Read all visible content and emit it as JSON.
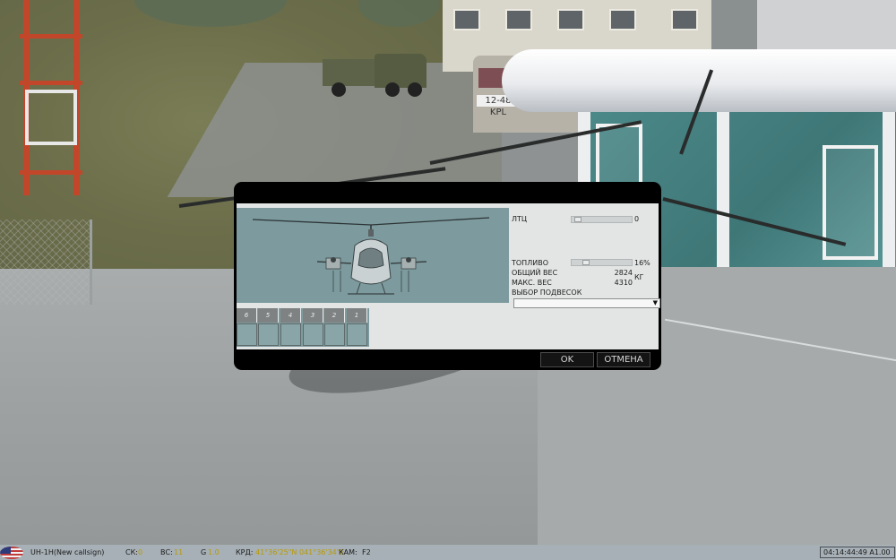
{
  "scene": {
    "bus_plate": "12-48 KPL"
  },
  "dialog": {
    "rows": {
      "ltc_label": "ЛТЦ",
      "ltc_value": "0",
      "fuel_label": "ТОПЛИВО",
      "fuel_value": "16%",
      "fuel_level": 0.16,
      "total_weight_label": "ОБЩИЙ ВЕС",
      "total_weight_value": "2824",
      "max_weight_label": "МАКС. ВЕС",
      "max_weight_value": "4310",
      "weight_unit": "КГ",
      "loadout_label": "ВЫБОР ПОДВЕСОК",
      "loadout_selected": ""
    },
    "pylons": [
      "6",
      "5",
      "4",
      "3",
      "2",
      "1"
    ],
    "buttons": {
      "ok": "OK",
      "cancel": "ОТМЕНА"
    }
  },
  "statusbar": {
    "aircraft": "UH-1H(New callsign)",
    "speed_label": "СК:",
    "speed_value": "0",
    "altitude_label": "ВС:",
    "altitude_value": "11",
    "g_label": "G",
    "g_value": "1.0",
    "coords_label": "КРД:",
    "coords_value": "41°36'25\"N 041°36'34\"E",
    "camera_label": "КАМ:",
    "camera_value": "F2",
    "clock": "04:14:44:49 A1.00"
  },
  "colors": {
    "dialog_bg": "#000000",
    "preview_bg": "#7d9b9e",
    "status_bg": "#a7b0b6",
    "status_value": "#b99a00"
  }
}
